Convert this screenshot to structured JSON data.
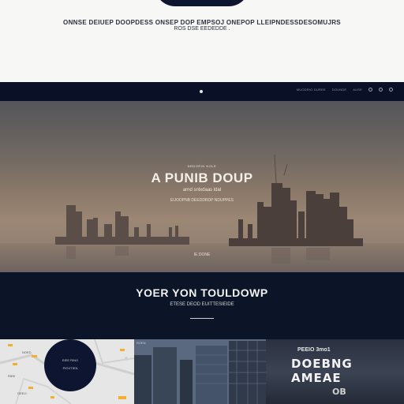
{
  "header": {
    "line1": "ONNSE DEIUEP  DOOPDESS ONSEP DOP EMPSOJ ONEPOP LLEIPNDESSDESOMUJRS",
    "line2": "ROS  DSE EEDEDDE ."
  },
  "nav": {
    "links": [
      "MUODRIO DUREE",
      "DOUNDE",
      "AUSE"
    ],
    "icons": [
      "search-icon",
      "user-icon",
      "menu-icon"
    ]
  },
  "hero": {
    "kicker": "NRDORIN NOLE",
    "title": "A PUNIB DOUP",
    "subtitle": "arnd snlxdaas ldal",
    "tagline": "EUOOPNB DEEDDRDP NDUPPES",
    "caption": "IE DONE"
  },
  "section": {
    "title": "YOER YON TOULDOWP",
    "subtitle": "ETESE DEOD EUITTESIEIDE"
  },
  "gallery": {
    "map": {
      "circle_line1": "EIEE RINO",
      "circle_line2": "PIOXTIEN",
      "labels": [
        "NOED",
        "RIEE",
        "OEEO"
      ]
    },
    "photo": {
      "label": "ROEN"
    },
    "sign": {
      "small": "PEEIO 3mo1",
      "line1": "DOEBNG",
      "line2": "AMEAE",
      "line3": "OB"
    }
  },
  "colors": {
    "navy": "#0c1428",
    "paper": "#f7f7f5",
    "accent": "#f0b030"
  }
}
